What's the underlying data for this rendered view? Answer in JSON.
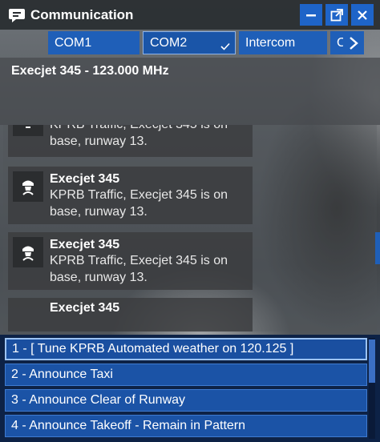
{
  "window": {
    "title": "Communication",
    "title_icon": "comms-bubble-icon",
    "buttons": [
      "minimize-icon",
      "undock-icon",
      "close-icon"
    ]
  },
  "tabs": {
    "items": [
      {
        "label": "COM1",
        "active": false
      },
      {
        "label": "COM2",
        "active": true
      },
      {
        "label": "Intercom",
        "active": false
      },
      {
        "label": "C",
        "active": false
      }
    ],
    "next_icon": "chevron-right-icon"
  },
  "frequency": {
    "label": "Execjet 345 - 123.000 MHz"
  },
  "messages": [
    {
      "sender": "",
      "line1": "KPRB Traffic, Execjet 345 is on",
      "line2": "base, runway 13."
    },
    {
      "sender": "Execjet 345",
      "line1": "KPRB Traffic, Execjet 345 is on",
      "line2": "base, runway 13."
    },
    {
      "sender": "Execjet 345",
      "line1": "KPRB Traffic, Execjet 345 is on",
      "line2": "base, runway 13."
    },
    {
      "sender": "Execjet 345",
      "line1": "",
      "line2": ""
    }
  ],
  "responses": [
    {
      "label": "1 - [ Tune KPRB Automated weather on 120.125 ]"
    },
    {
      "label": "2 - Announce Taxi"
    },
    {
      "label": "3 - Announce Clear of Runway"
    },
    {
      "label": "4 - Announce Takeoff - Remain in Pattern"
    }
  ],
  "colors": {
    "accent_blue": "#1f5fb8",
    "titlebar": "#282c30",
    "response_bg": "#1b53a6"
  }
}
